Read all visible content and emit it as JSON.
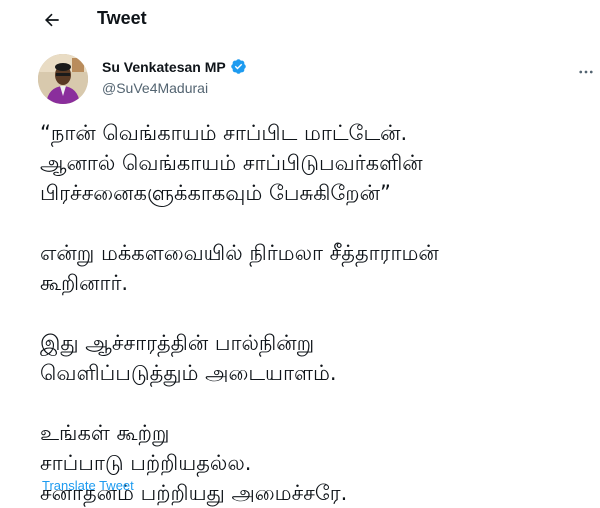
{
  "header": {
    "title": "Tweet",
    "back_icon": "arrow-left-icon"
  },
  "author": {
    "name": "Su Venkatesan MP",
    "handle": "@SuVe4Madurai",
    "verified": true,
    "verified_color": "#1d9bf0",
    "more_icon": "more-horizontal-icon"
  },
  "tweet": {
    "text": "“நான் வெங்காயம் சாப்பிட மாட்டேன்.\nஆனால் வெங்காயம் சாப்பிடுபவர்களின்\nபிரச்சனைகளுக்காகவும் பேசுகிறேன்”\n\nஎன்று மக்களவையில் நிர்மலா சீத்தாராமன்\nகூறினார்.\n\nஇது ஆச்சாரத்தின் பால்நின்று\nவெளிப்படுத்தும் அடையாளம்.\n\nஉங்கள் கூற்று\nசாப்பாடு பற்றியதல்ல.\nசனாதனம் பற்றியது அமைச்சரே.",
    "translate_label": "Translate Tweet"
  },
  "colors": {
    "link": "#1d9bf0",
    "text": "#0f1419",
    "secondary": "#536471"
  }
}
